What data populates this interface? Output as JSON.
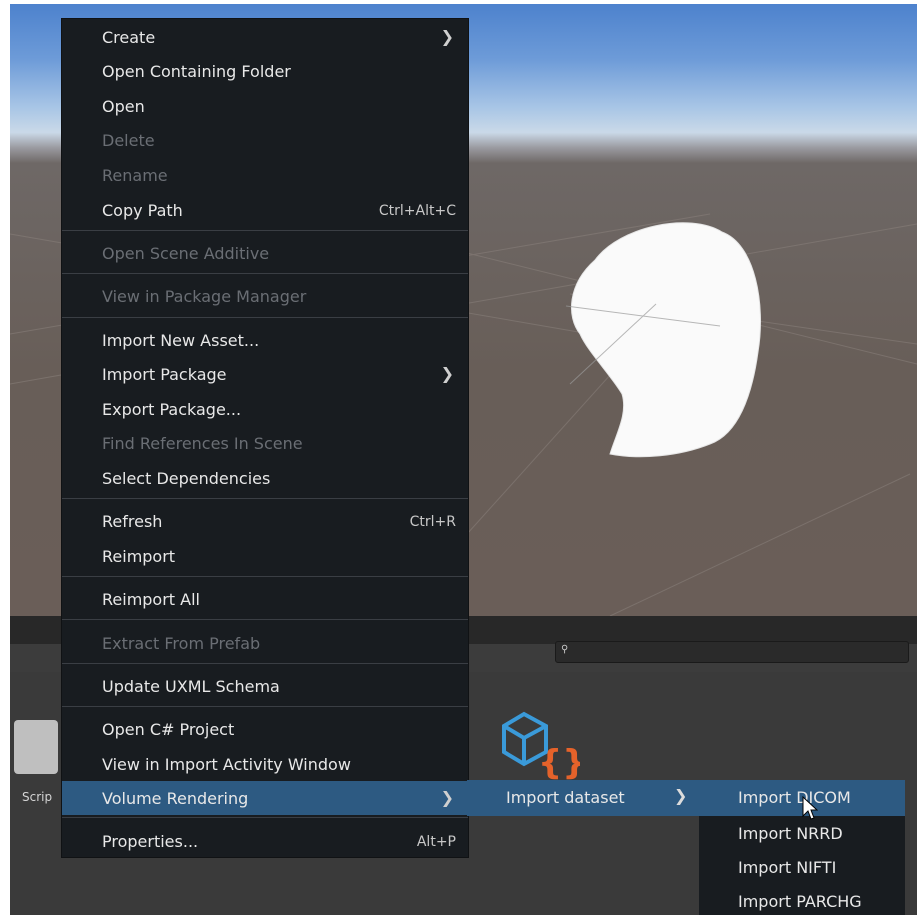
{
  "context_menu": {
    "items": [
      {
        "label": "Create",
        "shortcut": "",
        "submenu": true,
        "enabled": true
      },
      {
        "label": "Open Containing Folder",
        "shortcut": "",
        "submenu": false,
        "enabled": true
      },
      {
        "label": "Open",
        "shortcut": "",
        "submenu": false,
        "enabled": true
      },
      {
        "label": "Delete",
        "shortcut": "",
        "submenu": false,
        "enabled": false
      },
      {
        "label": "Rename",
        "shortcut": "",
        "submenu": false,
        "enabled": false
      },
      {
        "label": "Copy Path",
        "shortcut": "Ctrl+Alt+C",
        "submenu": false,
        "enabled": true
      },
      {
        "label": "Open Scene Additive",
        "shortcut": "",
        "submenu": false,
        "enabled": false
      },
      {
        "label": "View in Package Manager",
        "shortcut": "",
        "submenu": false,
        "enabled": false
      },
      {
        "label": "Import New Asset...",
        "shortcut": "",
        "submenu": false,
        "enabled": true
      },
      {
        "label": "Import Package",
        "shortcut": "",
        "submenu": true,
        "enabled": true
      },
      {
        "label": "Export Package...",
        "shortcut": "",
        "submenu": false,
        "enabled": true
      },
      {
        "label": "Find References In Scene",
        "shortcut": "",
        "submenu": false,
        "enabled": false
      },
      {
        "label": "Select Dependencies",
        "shortcut": "",
        "submenu": false,
        "enabled": true
      },
      {
        "label": "Refresh",
        "shortcut": "Ctrl+R",
        "submenu": false,
        "enabled": true
      },
      {
        "label": "Reimport",
        "shortcut": "",
        "submenu": false,
        "enabled": true
      },
      {
        "label": "Reimport All",
        "shortcut": "",
        "submenu": false,
        "enabled": true
      },
      {
        "label": "Extract From Prefab",
        "shortcut": "",
        "submenu": false,
        "enabled": false
      },
      {
        "label": "Update UXML Schema",
        "shortcut": "",
        "submenu": false,
        "enabled": true
      },
      {
        "label": "Open C# Project",
        "shortcut": "",
        "submenu": false,
        "enabled": true
      },
      {
        "label": "View in Import Activity Window",
        "shortcut": "",
        "submenu": false,
        "enabled": true
      },
      {
        "label": "Volume Rendering",
        "shortcut": "",
        "submenu": true,
        "enabled": true,
        "highlighted": true
      },
      {
        "label": "Properties...",
        "shortcut": "Alt+P",
        "submenu": false,
        "enabled": true
      }
    ]
  },
  "submenu_volume_rendering": {
    "items": [
      {
        "label": "Import dataset",
        "submenu": true,
        "highlighted": true
      }
    ]
  },
  "submenu_import_dataset": {
    "items": [
      {
        "label": "Import DICOM",
        "highlighted": true
      },
      {
        "label": "Import NRRD"
      },
      {
        "label": "Import NIFTI"
      },
      {
        "label": "Import PARCHG"
      }
    ]
  },
  "project_panel": {
    "folder_label": "Scrip",
    "search_icon": "search-icon"
  },
  "colors": {
    "menu_bg": "#181c20",
    "highlight": "#2d5a82",
    "disabled_text": "#6a6e74",
    "script_icon_blue": "#3a9ad9",
    "script_icon_orange": "#e5622a"
  }
}
